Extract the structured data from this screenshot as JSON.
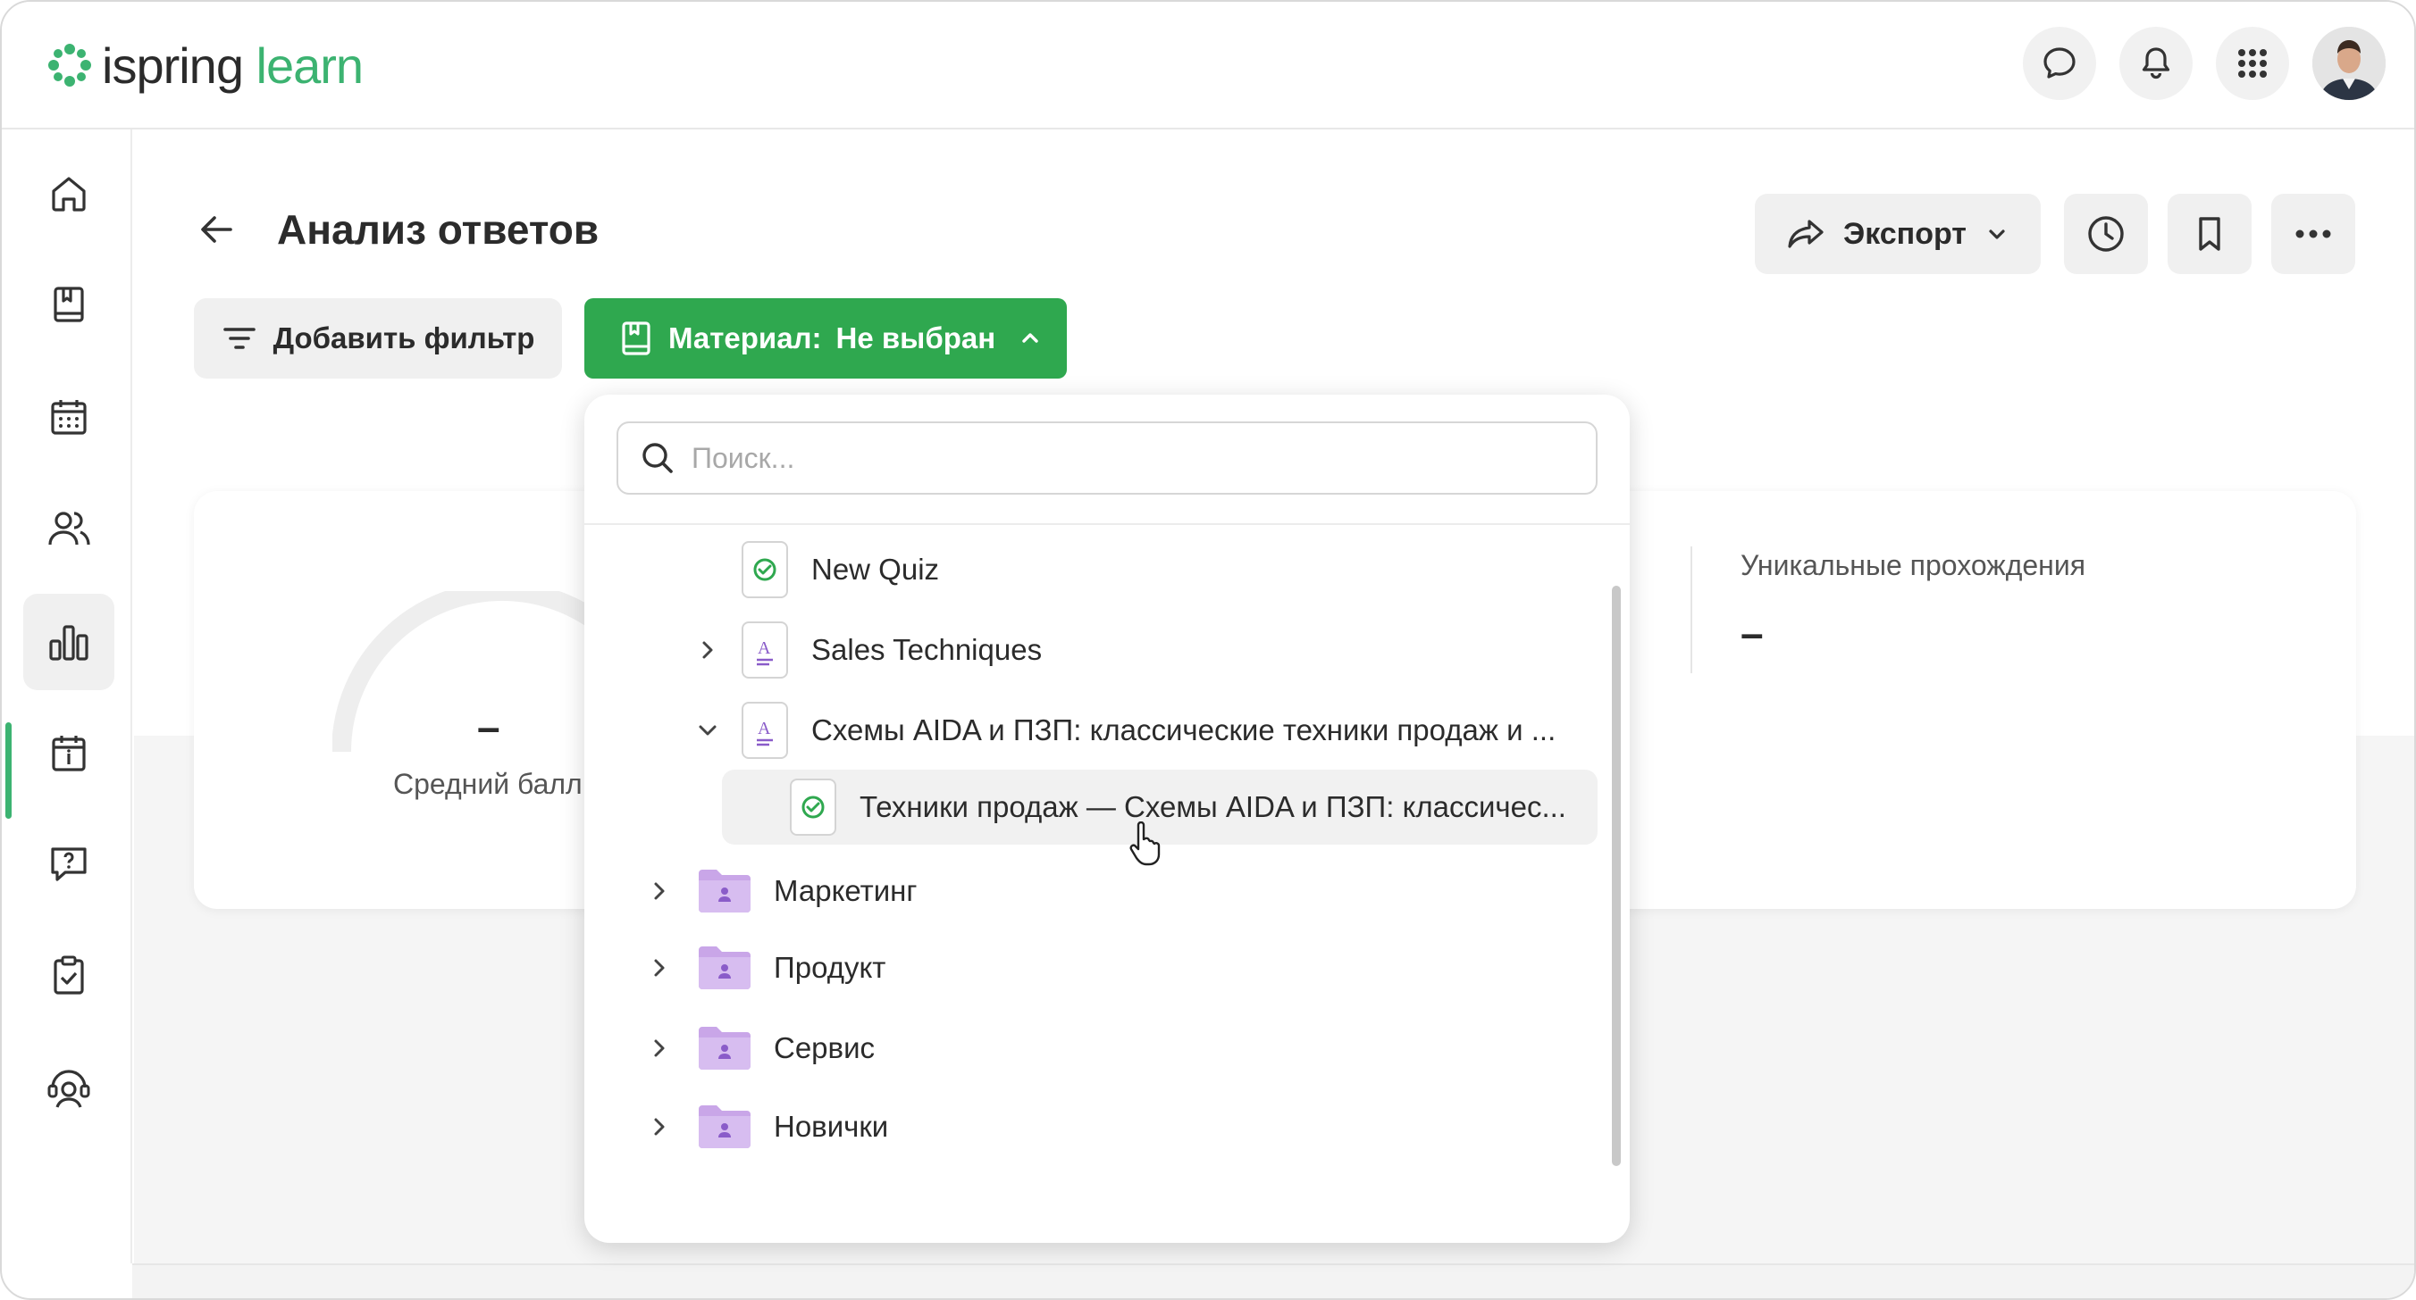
{
  "header": {
    "logo": {
      "part1": "ispring",
      "part2": "learn"
    },
    "icons": [
      "chat-icon",
      "bell-icon",
      "apps-grid-icon",
      "user-avatar"
    ]
  },
  "sidebar": {
    "items": [
      {
        "icon": "home-icon",
        "active": false
      },
      {
        "icon": "book-icon",
        "active": false
      },
      {
        "icon": "calendar-icon",
        "active": false
      },
      {
        "icon": "users-icon",
        "active": false
      },
      {
        "icon": "chart-icon",
        "active": true
      },
      {
        "icon": "info-calendar-icon",
        "active": false
      },
      {
        "icon": "question-icon",
        "active": false
      },
      {
        "icon": "clipboard-check-icon",
        "active": false
      },
      {
        "icon": "support-icon",
        "active": false
      }
    ]
  },
  "page": {
    "title": "Анализ ответов",
    "export_label": "Экспорт",
    "add_filter_label": "Добавить фильтр",
    "material_prefix": "Материал:",
    "material_value": "Не выбран"
  },
  "stats": {
    "average_label": "Средний балл",
    "average_value": "–",
    "unique_label": "Уникальные прохождения",
    "unique_value": "–"
  },
  "dropdown": {
    "search_placeholder": "Поиск...",
    "items": [
      {
        "label": "New Quiz",
        "type": "quiz"
      },
      {
        "label": "Sales Techniques",
        "type": "course",
        "expanded": false
      },
      {
        "label": "Схемы AIDA и ПЗП: классические техники продаж и ...",
        "type": "course",
        "expanded": true
      },
      {
        "label": "Техники продаж — Схемы AIDA и ПЗП: классичес...",
        "type": "quiz",
        "hovered": true
      },
      {
        "label": "Маркетинг",
        "type": "folder"
      },
      {
        "label": "Продукт",
        "type": "folder"
      },
      {
        "label": "Сервис",
        "type": "folder"
      },
      {
        "label": "Новички",
        "type": "folder"
      }
    ]
  },
  "colors": {
    "accent_green": "#2fa84f",
    "logo_green": "#3cb371",
    "folder_purple": "#c9a6e8",
    "course_icon_purple": "#8a5cc9"
  }
}
